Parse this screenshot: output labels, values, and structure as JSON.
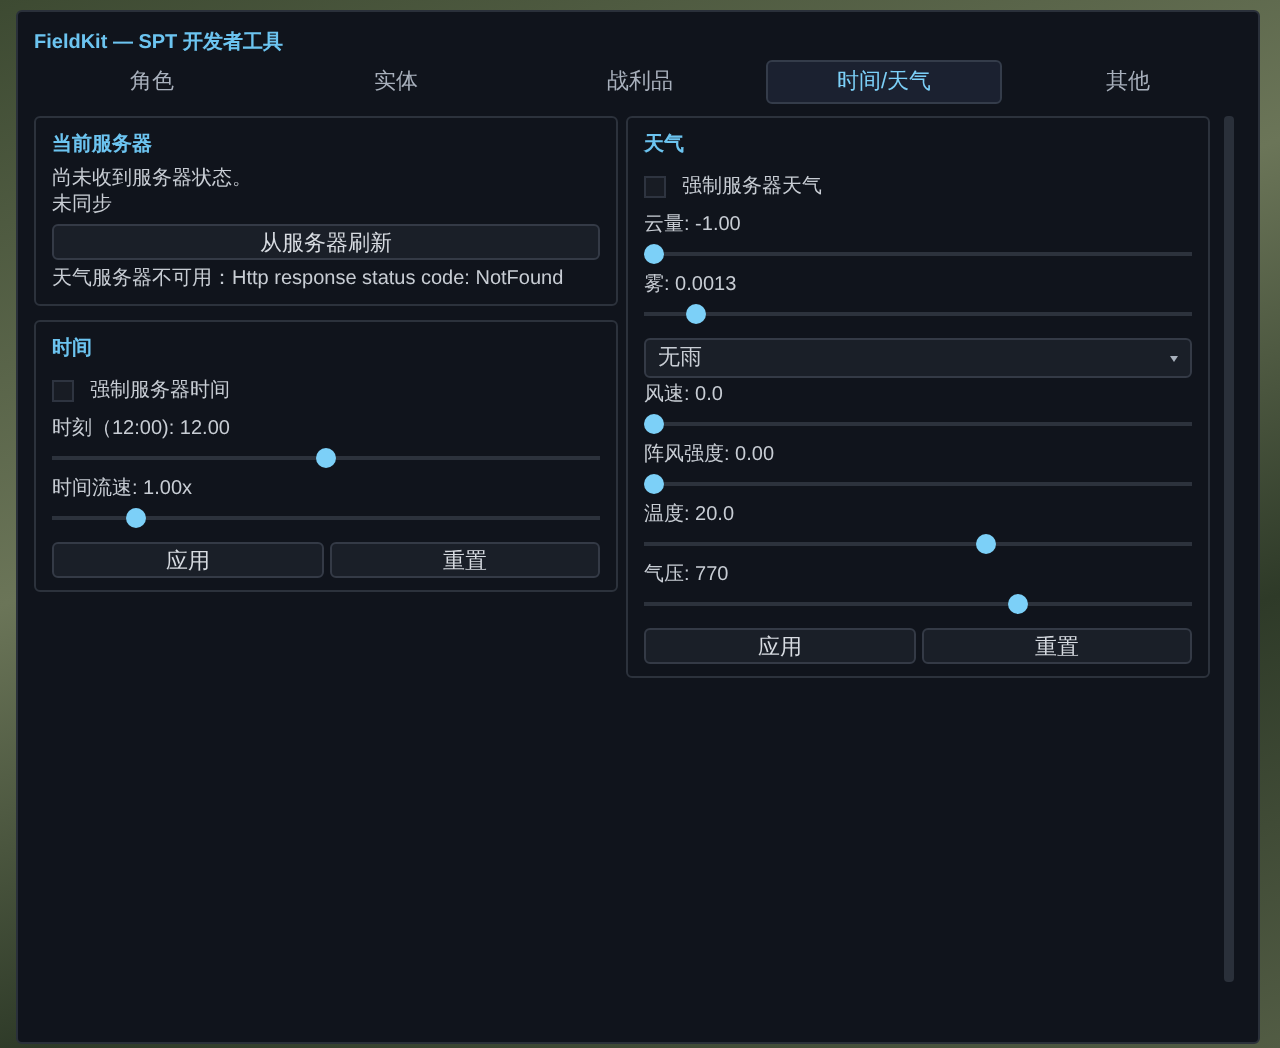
{
  "window": {
    "title": "FieldKit — SPT 开发者工具"
  },
  "tabs": [
    {
      "label": "角色",
      "selected": false
    },
    {
      "label": "实体",
      "selected": false
    },
    {
      "label": "战利品",
      "selected": false
    },
    {
      "label": "时间/天气",
      "selected": true
    },
    {
      "label": "其他",
      "selected": false
    }
  ],
  "server": {
    "title": "当前服务器",
    "status": "尚未收到服务器状态。",
    "sync": "未同步",
    "refresh_button": "从服务器刷新",
    "error": "天气服务器不可用：Http response status code: NotFound"
  },
  "time": {
    "title": "时间",
    "force": {
      "label": "强制服务器时间",
      "checked": false
    },
    "sliders": [
      {
        "label": "时刻（12:00): 12.00",
        "level": 0.5
      },
      {
        "label": "时间流速: 1.00x",
        "level": 0.14
      }
    ],
    "buttons": [
      "应用",
      "重置"
    ]
  },
  "weather": {
    "title": "天气",
    "force": {
      "label": "强制服务器天气",
      "checked": false
    },
    "controls": [
      {
        "kind": "slider",
        "label": "云量: -1.00",
        "level": 0
      },
      {
        "kind": "slider",
        "label": "雾: 0.0013",
        "level": 0.08
      },
      {
        "kind": "dropdown",
        "value": "无雨"
      },
      {
        "kind": "slider",
        "label": "风速: 0.0",
        "level": 0
      },
      {
        "kind": "slider",
        "label": "阵风强度: 0.00",
        "level": 0
      },
      {
        "kind": "slider",
        "label": "温度: 20.0",
        "level": 0.63
      },
      {
        "kind": "slider",
        "label": "气压: 770",
        "level": 0.69
      }
    ],
    "buttons": [
      "应用",
      "重置"
    ]
  }
}
